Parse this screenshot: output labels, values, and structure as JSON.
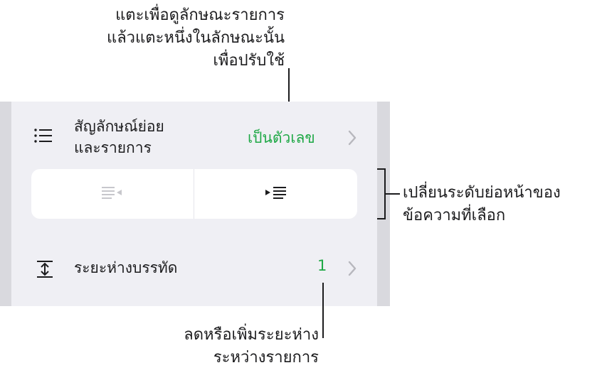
{
  "callouts": {
    "top": [
      "แตะเพื่อดูลักษณะรายการ",
      "แล้วแตะหนึ่งในลักษณะนั้น",
      "เพื่อปรับใช้"
    ],
    "right": [
      "เปลี่ยนระดับย่อหน้าของ",
      "ข้อความที่เลือก"
    ],
    "bottom": [
      "ลดหรือเพิ่มระยะห่าง",
      "ระหว่างรายการ"
    ]
  },
  "bullets_row": {
    "icon": "list-bullets-icon",
    "title_lines": [
      "สัญลักษณ์ย่อย",
      "และรายการ"
    ],
    "value": "เป็นตัวเลข"
  },
  "indent": {
    "decrease_icon": "outdent-icon",
    "increase_icon": "indent-icon"
  },
  "spacing_row": {
    "icon": "line-spacing-icon",
    "title": "ระยะห่างบรรทัด",
    "value": "1"
  },
  "colors": {
    "accent": "#1ea845",
    "panel_bg": "#efeff4",
    "panel_edge": "#d9d9de"
  }
}
